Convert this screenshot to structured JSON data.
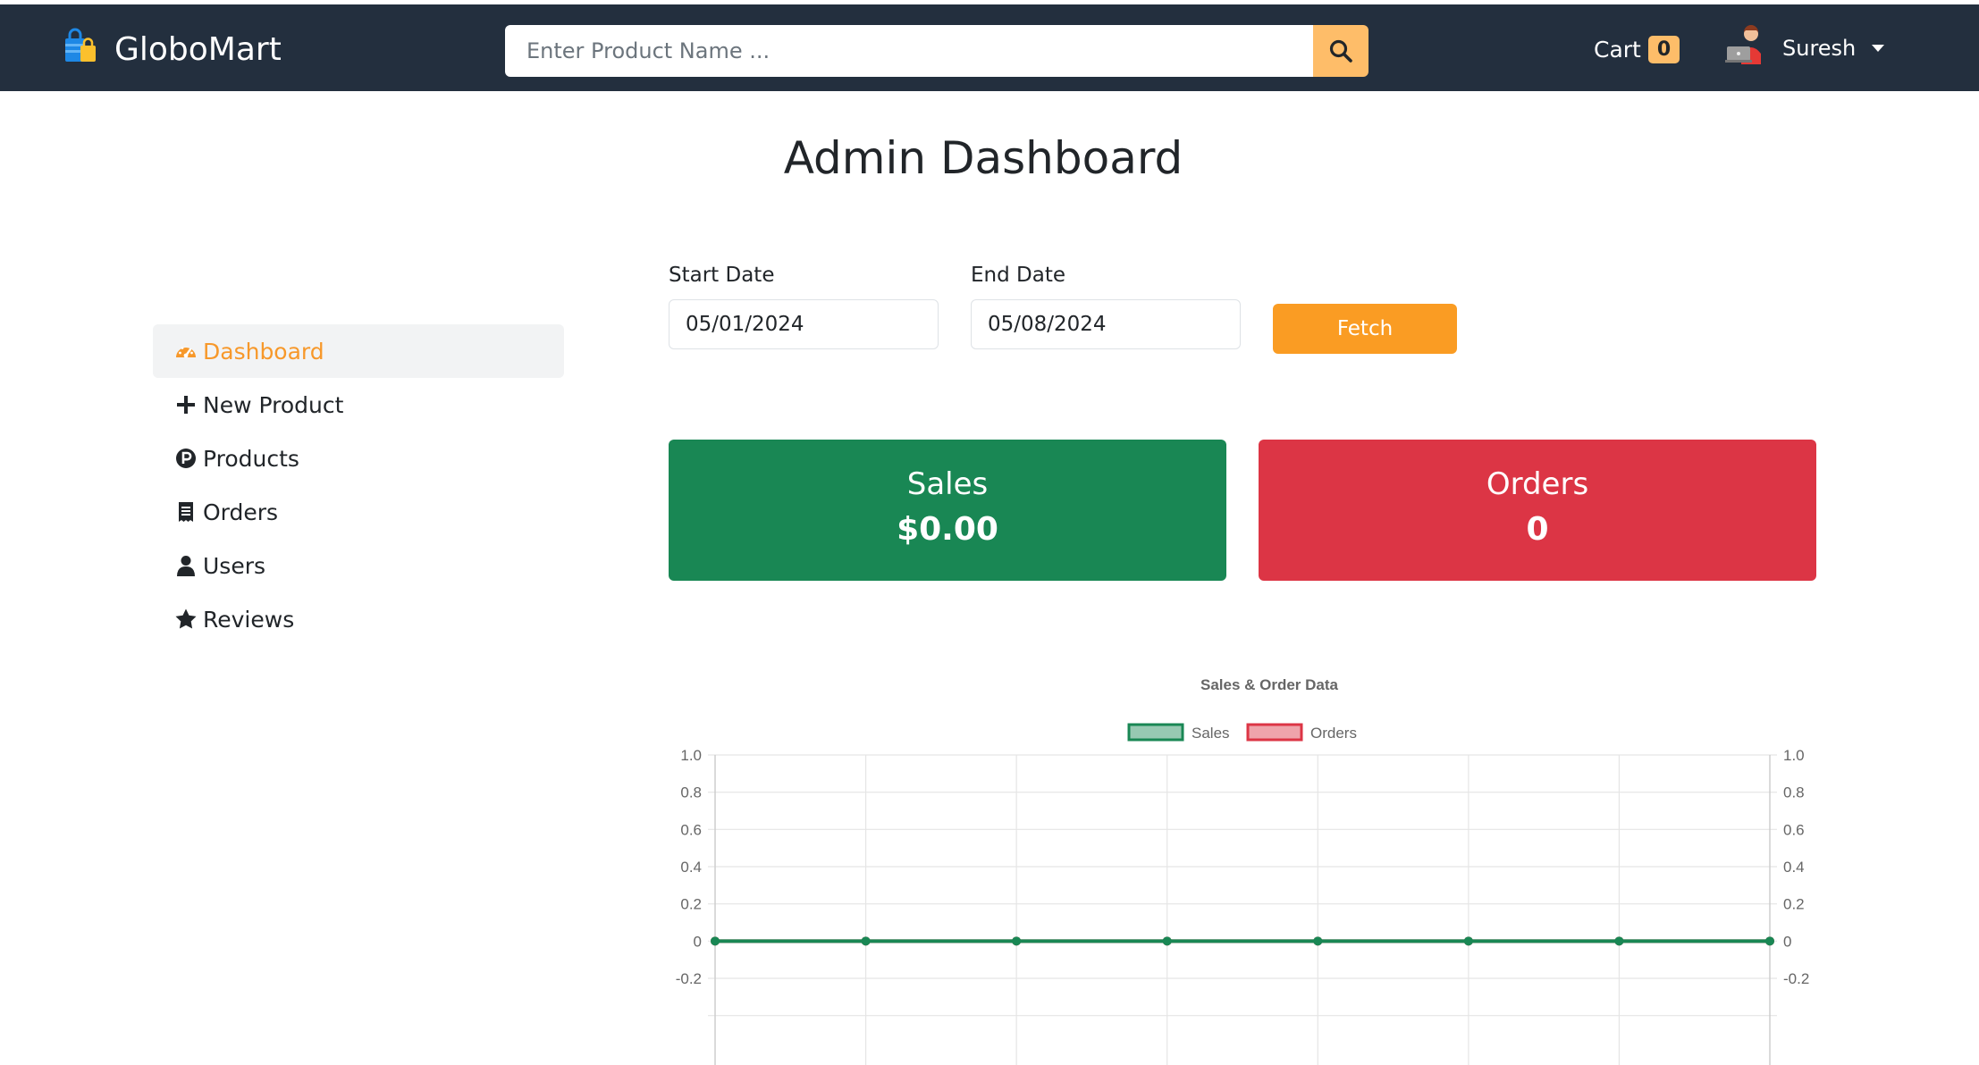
{
  "header": {
    "brand": "GloboMart",
    "search_placeholder": "Enter Product Name ...",
    "cart_label": "Cart",
    "cart_count": "0",
    "user_name": "Suresh"
  },
  "page": {
    "title": "Admin Dashboard"
  },
  "sidebar": {
    "items": [
      {
        "label": "Dashboard",
        "icon": "gauge-icon",
        "active": true
      },
      {
        "label": "New Product",
        "icon": "plus-icon",
        "active": false
      },
      {
        "label": "Products",
        "icon": "product-p-icon",
        "active": false
      },
      {
        "label": "Orders",
        "icon": "receipt-icon",
        "active": false
      },
      {
        "label": "Users",
        "icon": "user-icon",
        "active": false
      },
      {
        "label": "Reviews",
        "icon": "star-icon",
        "active": false
      }
    ]
  },
  "filters": {
    "start_label": "Start Date",
    "start_value": "05/01/2024",
    "end_label": "End Date",
    "end_value": "05/08/2024",
    "fetch_label": "Fetch"
  },
  "stats": {
    "sales": {
      "label": "Sales",
      "value": "$0.00"
    },
    "orders": {
      "label": "Orders",
      "value": "0"
    }
  },
  "colors": {
    "navbar": "#232f3e",
    "accent": "#febd69",
    "fetch": "#fa9c23",
    "sales": "#198754",
    "orders": "#dc3545"
  },
  "chart_data": {
    "type": "line",
    "title": "Sales & Order Data",
    "categories": [
      "",
      "",
      "",
      "",
      "",
      "",
      "",
      ""
    ],
    "series": [
      {
        "name": "Sales",
        "values": [
          0,
          0,
          0,
          0,
          0,
          0,
          0,
          0
        ],
        "color": "#198754"
      },
      {
        "name": "Orders",
        "values": [
          0,
          0,
          0,
          0,
          0,
          0,
          0,
          0
        ],
        "color": "#dc3545"
      }
    ],
    "y_ticks": [
      "1.0",
      "0.8",
      "0.6",
      "0.4",
      "0.2",
      "0",
      "-0.2"
    ],
    "ylim": [
      -0.2,
      1.0
    ],
    "legend": "top",
    "grid": true
  }
}
